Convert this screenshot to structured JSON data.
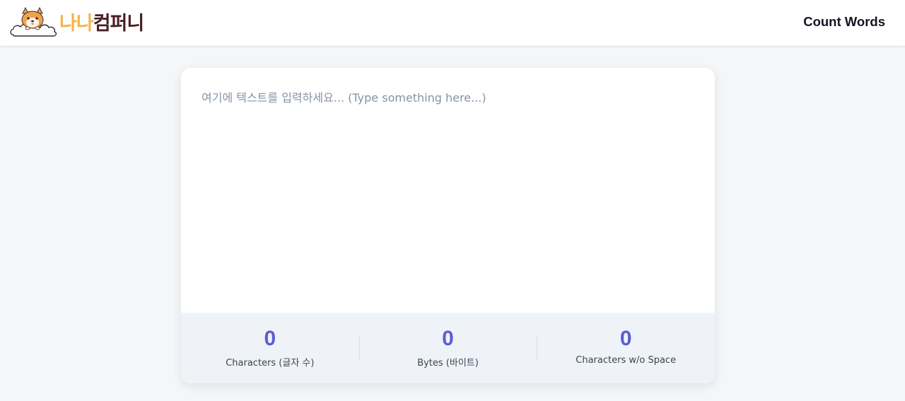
{
  "header": {
    "logo": {
      "text_a": "나나",
      "text_b": "컴퍼니",
      "mascot_icon": "shiba-dog-on-cloud-icon"
    },
    "nav_title": "Count Words"
  },
  "editor": {
    "placeholder": "여기에 텍스트를 입력하세요... (Type something here...)",
    "value": ""
  },
  "stats": [
    {
      "value": "0",
      "label": "Characters (글자 수)"
    },
    {
      "value": "0",
      "label": "Bytes (바이트)"
    },
    {
      "value": "0",
      "label": "Characters w/o Space"
    }
  ],
  "colors": {
    "accent": "#5b5cd6",
    "logo_orange": "#f4b34a",
    "logo_brown": "#4a1f24",
    "stats_background": "#eff3f8",
    "page_background": "#f5f6f8"
  }
}
